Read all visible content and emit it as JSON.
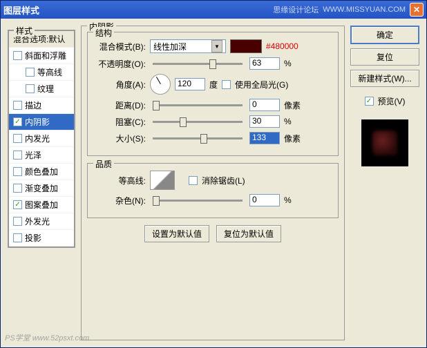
{
  "window": {
    "title": "图层样式",
    "site": "思缘设计论坛",
    "url": "WWW.MISSYUAN.COM"
  },
  "sidebar": {
    "section_label": "样式",
    "blend_header": "混合选项:默认",
    "items": [
      {
        "label": "斜面和浮雕",
        "checked": false
      },
      {
        "label": "等高线",
        "checked": false,
        "indent": true
      },
      {
        "label": "纹理",
        "checked": false,
        "indent": true
      },
      {
        "label": "描边",
        "checked": false
      },
      {
        "label": "内阴影",
        "checked": true,
        "selected": true
      },
      {
        "label": "内发光",
        "checked": false
      },
      {
        "label": "光泽",
        "checked": false
      },
      {
        "label": "颜色叠加",
        "checked": false
      },
      {
        "label": "渐变叠加",
        "checked": false
      },
      {
        "label": "图案叠加",
        "checked": true
      },
      {
        "label": "外发光",
        "checked": false
      },
      {
        "label": "投影",
        "checked": false
      }
    ]
  },
  "panel": {
    "title": "内阴影",
    "structure": {
      "label": "结构",
      "blend_mode_label": "混合模式(B):",
      "blend_mode_value": "线性加深",
      "color_hex": "#480000",
      "opacity_label": "不透明度(O):",
      "opacity_value": "63",
      "opacity_unit": "%",
      "angle_label": "角度(A):",
      "angle_value": "120",
      "angle_unit": "度",
      "global_light_label": "使用全局光(G)",
      "global_light_checked": false,
      "distance_label": "距离(D):",
      "distance_value": "0",
      "distance_unit": "像素",
      "choke_label": "阻塞(C):",
      "choke_value": "30",
      "choke_unit": "%",
      "size_label": "大小(S):",
      "size_value": "133",
      "size_unit": "像素"
    },
    "quality": {
      "label": "品质",
      "contour_label": "等高线:",
      "antialias_label": "消除锯齿(L)",
      "antialias_checked": false,
      "noise_label": "杂色(N):",
      "noise_value": "0",
      "noise_unit": "%"
    },
    "buttons": {
      "default": "设置为默认值",
      "reset": "复位为默认值"
    }
  },
  "right": {
    "ok": "确定",
    "cancel": "复位",
    "new_style": "新建样式(W)...",
    "preview_label": "预览(V)",
    "preview_checked": true
  },
  "watermark": "PS学堂  www.52psxt.com"
}
